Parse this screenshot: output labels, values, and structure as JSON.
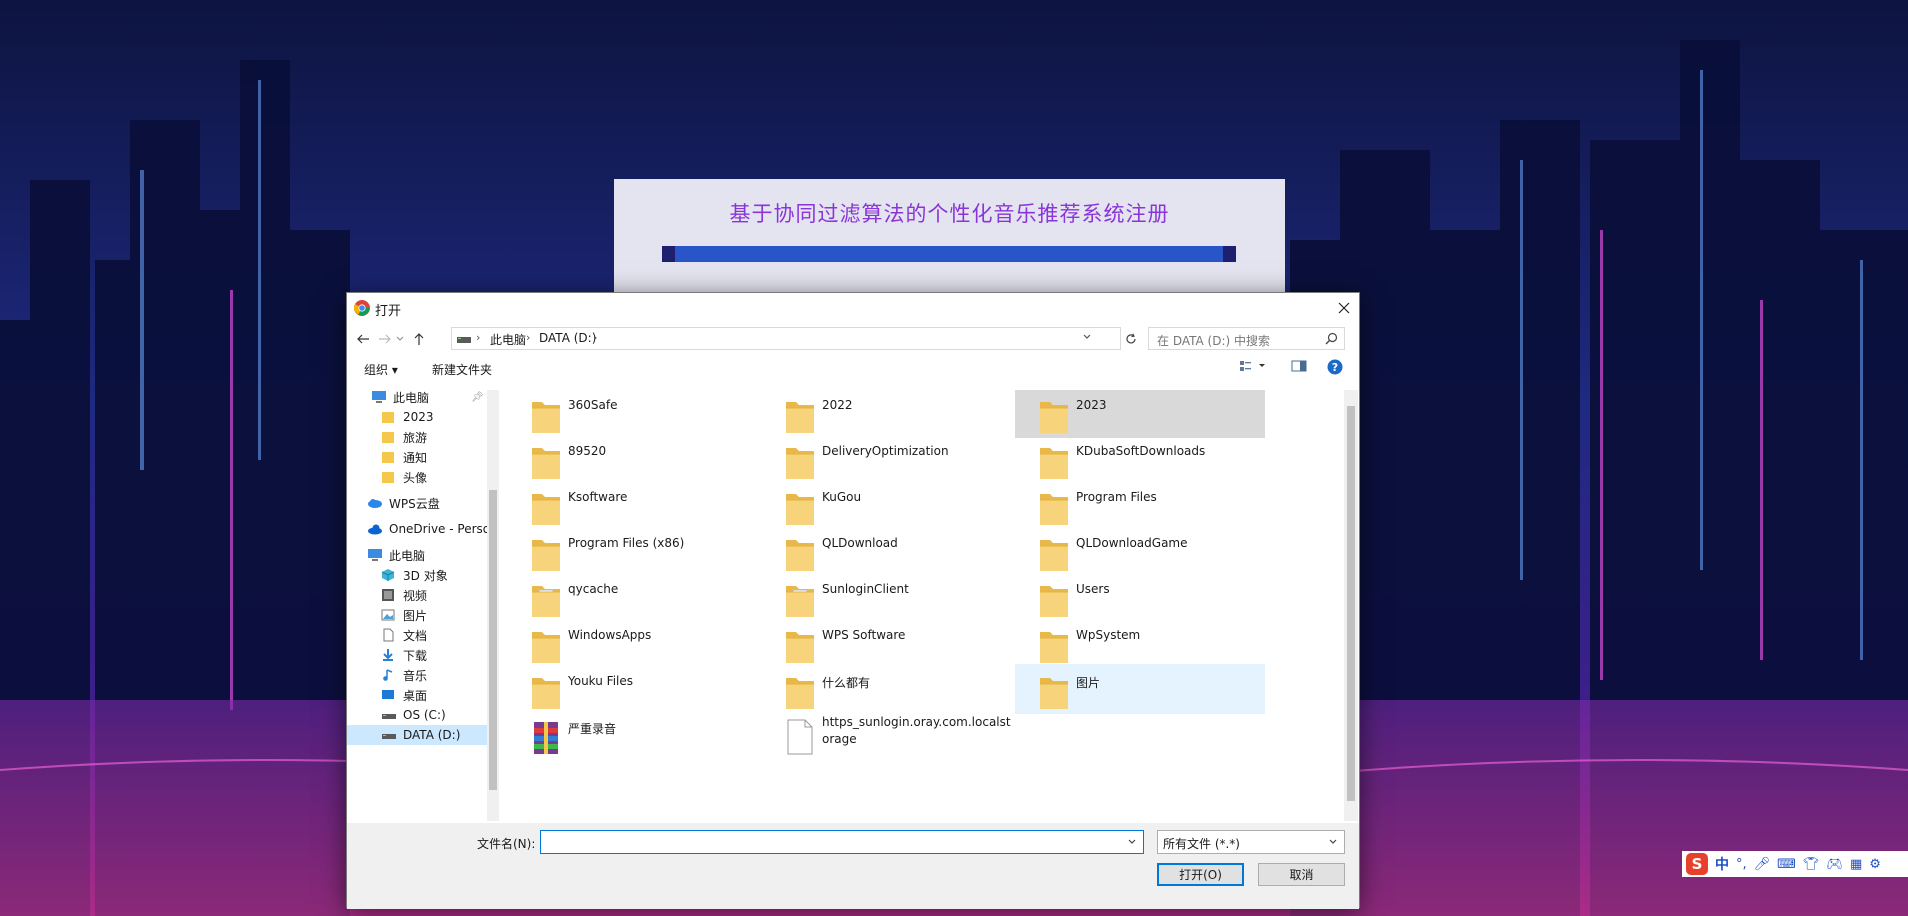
{
  "page": {
    "title": "基于协同过滤算法的个性化音乐推荐系统注册"
  },
  "dialog": {
    "title": "打开",
    "breadcrumb": [
      "此电脑",
      "DATA (D:)"
    ],
    "search_placeholder": "在 DATA (D:) 中搜索",
    "toolbar": {
      "organize": "组织",
      "new_folder": "新建文件夹"
    },
    "nav_items": [
      {
        "label": "此电脑",
        "icon": "computer-icon"
      },
      {
        "label": "2023",
        "icon": "folder-icon"
      },
      {
        "label": "旅游",
        "icon": "folder-icon"
      },
      {
        "label": "通知",
        "icon": "folder-icon"
      },
      {
        "label": "头像",
        "icon": "folder-icon"
      },
      {
        "label": "WPS云盘",
        "icon": "cloud-icon"
      },
      {
        "label": "OneDrive - Perso",
        "icon": "onedrive-icon"
      },
      {
        "label": "此电脑",
        "icon": "computer-icon"
      },
      {
        "label": "3D 对象",
        "icon": "cube-icon"
      },
      {
        "label": "视频",
        "icon": "video-icon"
      },
      {
        "label": "图片",
        "icon": "picture-icon"
      },
      {
        "label": "文档",
        "icon": "document-icon"
      },
      {
        "label": "下载",
        "icon": "download-icon"
      },
      {
        "label": "音乐",
        "icon": "music-icon"
      },
      {
        "label": "桌面",
        "icon": "desktop-icon"
      },
      {
        "label": "OS (C:)",
        "icon": "drive-icon"
      },
      {
        "label": "DATA (D:)",
        "icon": "drive-icon"
      }
    ],
    "files": [
      {
        "name": "360Safe",
        "type": "folder"
      },
      {
        "name": "2022",
        "type": "folder"
      },
      {
        "name": "2023",
        "type": "folder-images"
      },
      {
        "name": "89520",
        "type": "folder"
      },
      {
        "name": "DeliveryOptimization",
        "type": "folder"
      },
      {
        "name": "KDubaSoftDownloads",
        "type": "folder"
      },
      {
        "name": "Ksoftware",
        "type": "folder"
      },
      {
        "name": "KuGou",
        "type": "folder"
      },
      {
        "name": "Program Files",
        "type": "folder"
      },
      {
        "name": "Program Files (x86)",
        "type": "folder"
      },
      {
        "name": "QLDownload",
        "type": "folder"
      },
      {
        "name": "QLDownloadGame",
        "type": "folder"
      },
      {
        "name": "qycache",
        "type": "folder-doc"
      },
      {
        "name": "SunloginClient",
        "type": "folder-doc"
      },
      {
        "name": "Users",
        "type": "folder"
      },
      {
        "name": "WindowsApps",
        "type": "folder"
      },
      {
        "name": "WPS Software",
        "type": "folder"
      },
      {
        "name": "WpSystem",
        "type": "folder"
      },
      {
        "name": "Youku Files",
        "type": "folder"
      },
      {
        "name": "什么都有",
        "type": "folder"
      },
      {
        "name": "图片",
        "type": "folder-images"
      },
      {
        "name": "严重录音",
        "type": "archive"
      },
      {
        "name": "https_sunlogin.oray.com.localstorage",
        "type": "file"
      }
    ],
    "file_name_label": "文件名(N):",
    "file_name_value": "",
    "filter": "所有文件 (*.*)",
    "open_button": "打开(O)",
    "cancel_button": "取消"
  },
  "ime": {
    "logo": "S",
    "mode": "中"
  },
  "colors": {
    "accent": "#0078d7",
    "title_purple": "#8a35d8",
    "selected": "#d9d9d9",
    "hover": "#e5f3ff"
  }
}
